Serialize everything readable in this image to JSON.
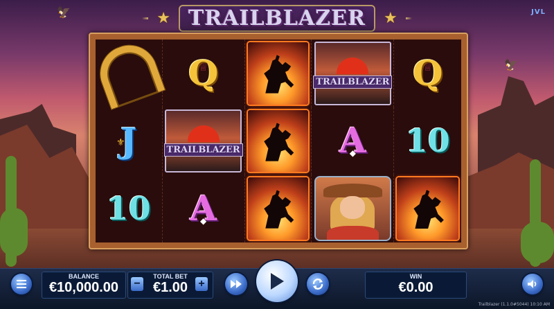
{
  "title": "TRAILBLAZER",
  "brand": "JVL",
  "reels": [
    [
      "horseshoe",
      "Q",
      "rider",
      "trailblazer",
      "Q"
    ],
    [
      "J",
      "trailblazer",
      "rider",
      "A",
      "10"
    ],
    [
      "10",
      "A",
      "rider",
      "cowgirl",
      "rider"
    ]
  ],
  "symbol_text": {
    "Q": "Q",
    "J": "J",
    "A": "A",
    "10": "10",
    "trailblazer": "TRAILBLAZER"
  },
  "bar": {
    "balance_label": "BALANCE",
    "balance_value": "€10,000.00",
    "total_bet_label": "TOTAL BET",
    "total_bet_value": "€1.00",
    "minus": "−",
    "plus": "+",
    "win_label": "WIN",
    "win_value": "€0.00"
  },
  "version_text": "Trailblazer (1.1.0#5044) 10:10 AM",
  "icons": {
    "menu": "menu-icon",
    "fast_forward": "fast-forward-icon",
    "spin": "play-icon",
    "autoplay": "autoplay-icon",
    "sound": "speaker-icon"
  }
}
